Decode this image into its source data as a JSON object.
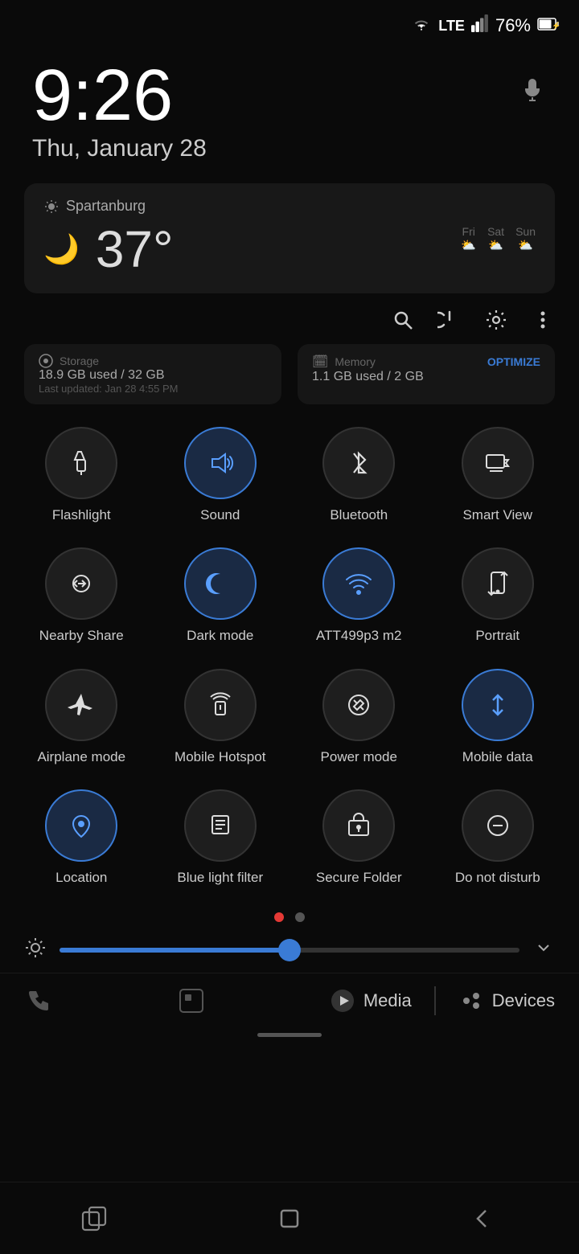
{
  "statusBar": {
    "battery": "76%",
    "icons": [
      "wifi",
      "lte",
      "signal"
    ]
  },
  "timeBlock": {
    "time": "9:26",
    "date": "Thu, January 28"
  },
  "weather": {
    "location": "Spartanburg",
    "temp": "37°",
    "days": [
      {
        "name": "Fri",
        "icon": "⛅"
      },
      {
        "name": "Sat",
        "icon": "⛅"
      },
      {
        "name": "Sun",
        "icon": "⛅"
      }
    ]
  },
  "qsHeader": {
    "icons": [
      "search",
      "power",
      "settings",
      "more"
    ]
  },
  "storageInfo": {
    "storage_label": "Storage",
    "storage_val": "18.9 GB used / 32 GB",
    "storage_update": "Last updated: Jan 28 4:55 PM",
    "memory_label": "Memory",
    "memory_val": "1.1 GB used / 2 GB",
    "memory_icon": "🗓"
  },
  "optimize_label": "OPTIMIZE",
  "tiles": [
    {
      "id": "flashlight",
      "label": "Flashlight",
      "icon": "🔦",
      "active": false
    },
    {
      "id": "sound",
      "label": "Sound",
      "icon": "🔊",
      "active": true
    },
    {
      "id": "bluetooth",
      "label": "Bluetooth",
      "icon": "⊛",
      "active": false
    },
    {
      "id": "smart-view",
      "label": "Smart View",
      "icon": "↻",
      "active": false
    },
    {
      "id": "nearby-share",
      "label": "Nearby Share",
      "icon": "⇄",
      "active": false
    },
    {
      "id": "dark-mode",
      "label": "Dark mode",
      "icon": "🌙",
      "active": true
    },
    {
      "id": "wifi-network",
      "label": "ATT499p3 m2",
      "icon": "📶",
      "active": true
    },
    {
      "id": "portrait",
      "label": "Portrait",
      "icon": "🔒",
      "active": false
    },
    {
      "id": "airplane",
      "label": "Airplane mode",
      "icon": "✈",
      "active": false
    },
    {
      "id": "mobile-hotspot",
      "label": "Mobile Hotspot",
      "icon": "📡",
      "active": false
    },
    {
      "id": "power-mode",
      "label": "Power mode",
      "icon": "♻",
      "active": false
    },
    {
      "id": "mobile-data",
      "label": "Mobile data",
      "icon": "⇅",
      "active": true
    },
    {
      "id": "location",
      "label": "Location",
      "icon": "📍",
      "active": true
    },
    {
      "id": "blue-light",
      "label": "Blue light filter",
      "icon": "📋",
      "active": false
    },
    {
      "id": "secure-folder",
      "label": "Secure Folder",
      "icon": "🗂",
      "active": false
    },
    {
      "id": "do-not-disturb",
      "label": "Do not disturb",
      "icon": "⊖",
      "active": false
    }
  ],
  "pageDots": [
    {
      "active": true
    },
    {
      "active": false
    }
  ],
  "brightness": {
    "value": 50
  },
  "mediaBar": {
    "media_label": "Media",
    "devices_label": "Devices"
  },
  "navBar": {
    "recent": "⬛",
    "home": "⬜",
    "back": "←"
  }
}
